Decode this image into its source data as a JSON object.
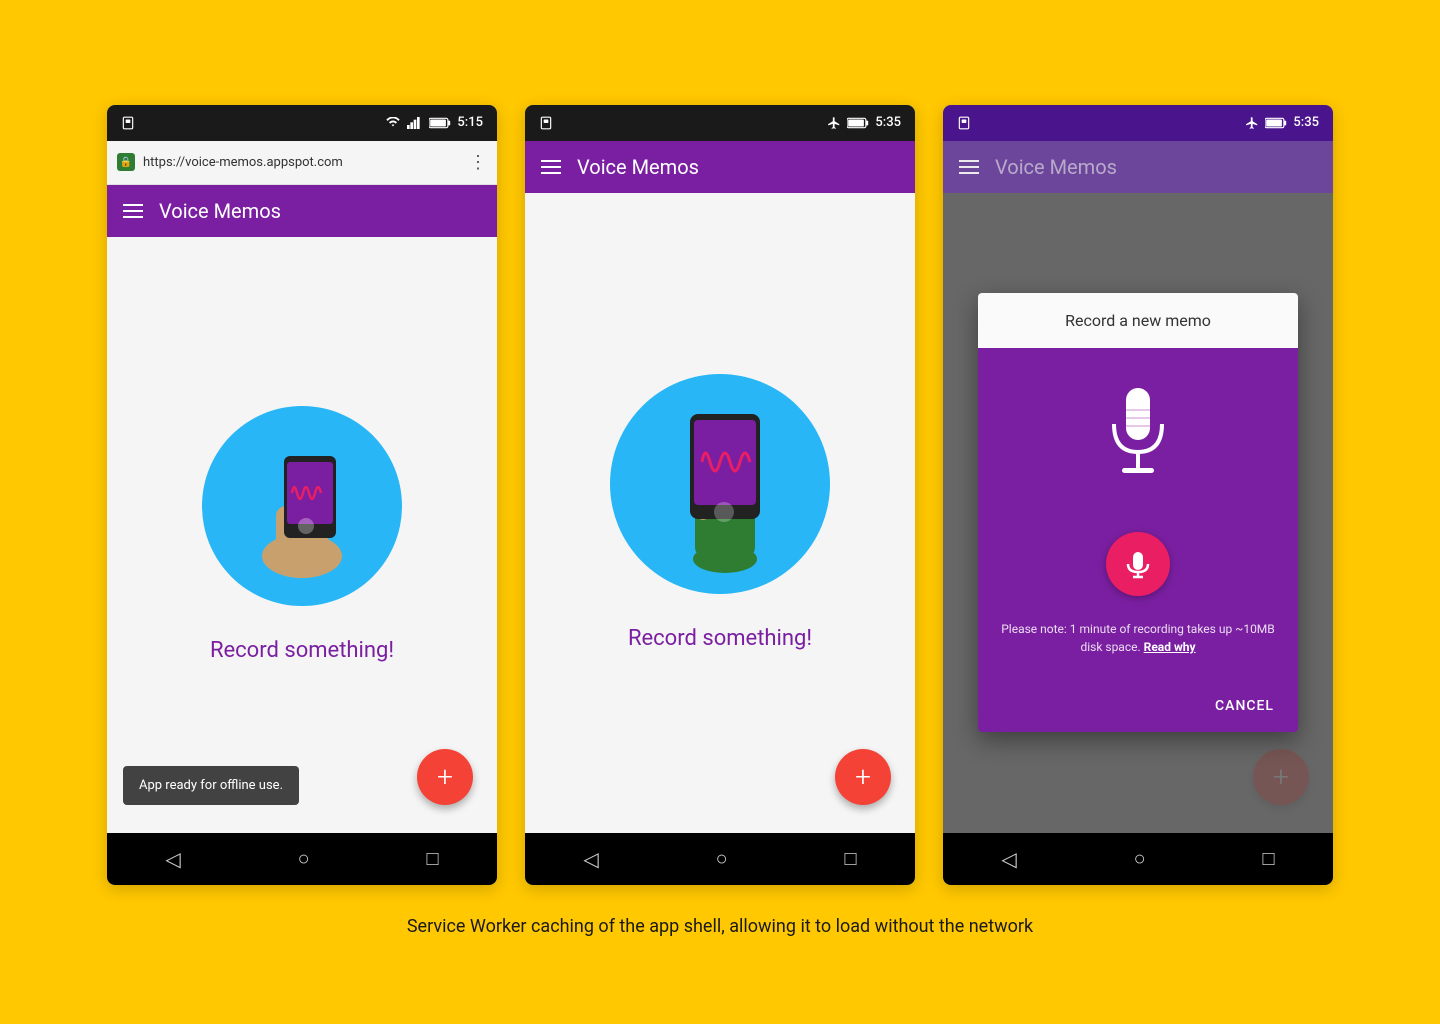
{
  "background_color": "#FFC800",
  "caption": "Service Worker caching of the app shell, allowing it to load without the network",
  "phones": [
    {
      "id": "phone1",
      "status_bar": {
        "left_icon": "sim-card",
        "wifi": true,
        "signal": true,
        "battery": true,
        "time": "5:15"
      },
      "url_bar": {
        "url": "https://voice-memos.appspot.com",
        "secure": true
      },
      "app_bar": {
        "title": "Voice Memos"
      },
      "main_text": "Record something!",
      "snackbar": "App ready for offline use.",
      "fab_label": "+"
    },
    {
      "id": "phone2",
      "status_bar": {
        "airplane": true,
        "battery": true,
        "time": "5:35"
      },
      "app_bar": {
        "title": "Voice Memos"
      },
      "main_text": "Record something!",
      "fab_label": "+"
    },
    {
      "id": "phone3",
      "status_bar": {
        "airplane": true,
        "battery": true,
        "time": "5:35"
      },
      "app_bar": {
        "title": "Voice Memos"
      },
      "dialog": {
        "title": "Record a new memo",
        "note": "Please note: 1 minute of recording takes up ~10MB disk space.",
        "read_why": "Read why",
        "cancel_label": "CANCEL"
      },
      "fab_label": "+"
    }
  ]
}
